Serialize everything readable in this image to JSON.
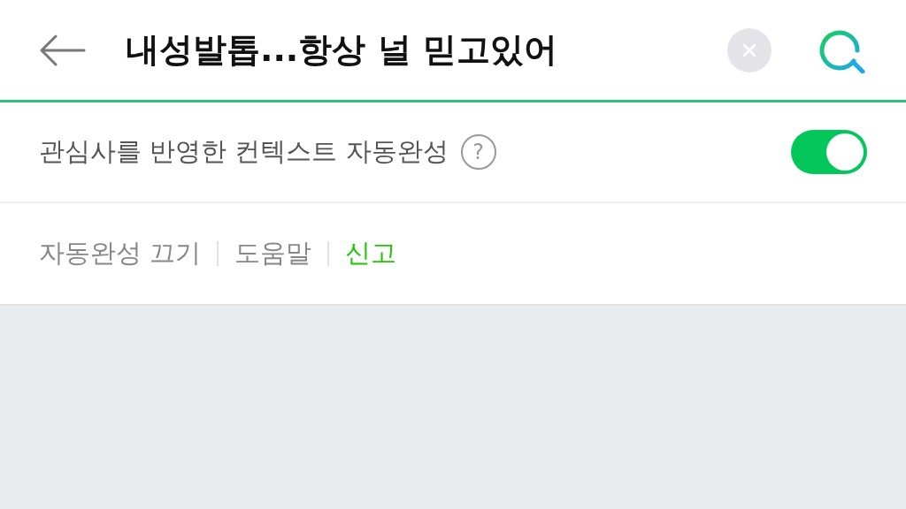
{
  "header": {
    "query": "내성발톱...항상 널 믿고있어"
  },
  "setting": {
    "label": "관심사를 반영한 컨텍스트 자동완성",
    "help": "?",
    "on": true
  },
  "footer_links": [
    {
      "label": "자동완성 끄기",
      "color": "#888888"
    },
    {
      "label": "도움말",
      "color": "#888888"
    },
    {
      "label": "신고",
      "color": "#1ec800"
    }
  ]
}
